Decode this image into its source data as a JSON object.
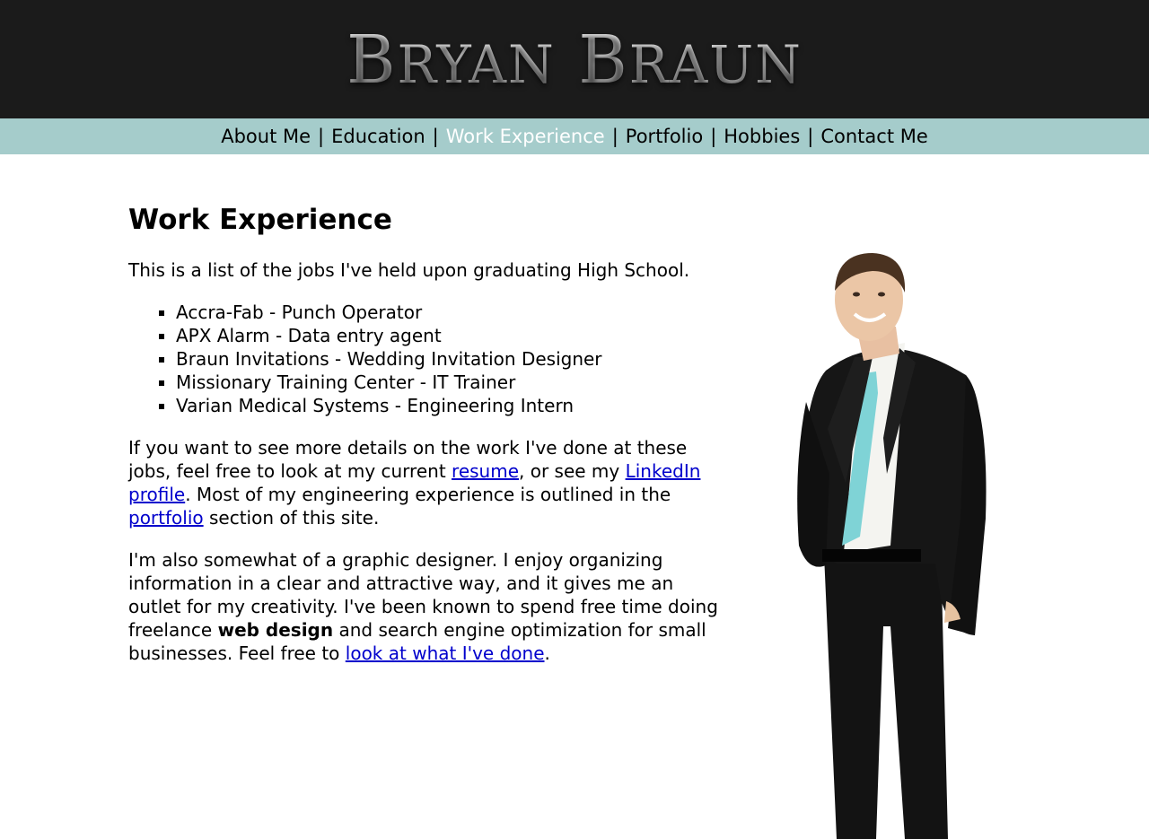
{
  "header": {
    "logo_first_initial": "B",
    "logo_first_rest": "RYAN",
    "logo_last_initial": "B",
    "logo_last_rest": "RAUN"
  },
  "nav": {
    "items": [
      {
        "label": "About Me",
        "active": false
      },
      {
        "label": "Education",
        "active": false
      },
      {
        "label": "Work Experience",
        "active": true
      },
      {
        "label": "Portfolio",
        "active": false
      },
      {
        "label": "Hobbies",
        "active": false
      },
      {
        "label": "Contact Me",
        "active": false
      }
    ],
    "separator": "|"
  },
  "main": {
    "title": "Work Experience",
    "intro": "This is a list of the jobs I've held upon graduating High School.",
    "jobs": [
      "Accra-Fab - Punch Operator",
      "APX Alarm - Data entry agent",
      "Braun Invitations - Wedding Invitation Designer",
      "Missionary Training Center - IT Trainer",
      "Varian Medical Systems - Engineering Intern"
    ],
    "details": {
      "text1": "If you want to see more details on the work I've done at these jobs, feel free to look at my current ",
      "resume_link": "resume",
      "text2": ", or see my ",
      "linkedin_link": "LinkedIn profile",
      "text3": ". Most of my engineering experience is outlined in the ",
      "portfolio_link": "portfolio",
      "text4": " section of this site."
    },
    "design": {
      "text1": "I'm also somewhat of a graphic designer. I enjoy organizing information in a clear and attractive way, and it gives me an outlet for my creativity. I've been known to spend free time doing freelance ",
      "bold": "web design",
      "text2": " and search engine optimization for small businesses. Feel free to ",
      "done_link": "look at what I've done",
      "text3": "."
    }
  },
  "colors": {
    "header_bg": "#1b1b1b",
    "nav_bg": "#a5cccb",
    "nav_active": "#ffffff",
    "link": "#0000cc",
    "tie": "#7fd3d6",
    "suit": "#141414"
  }
}
